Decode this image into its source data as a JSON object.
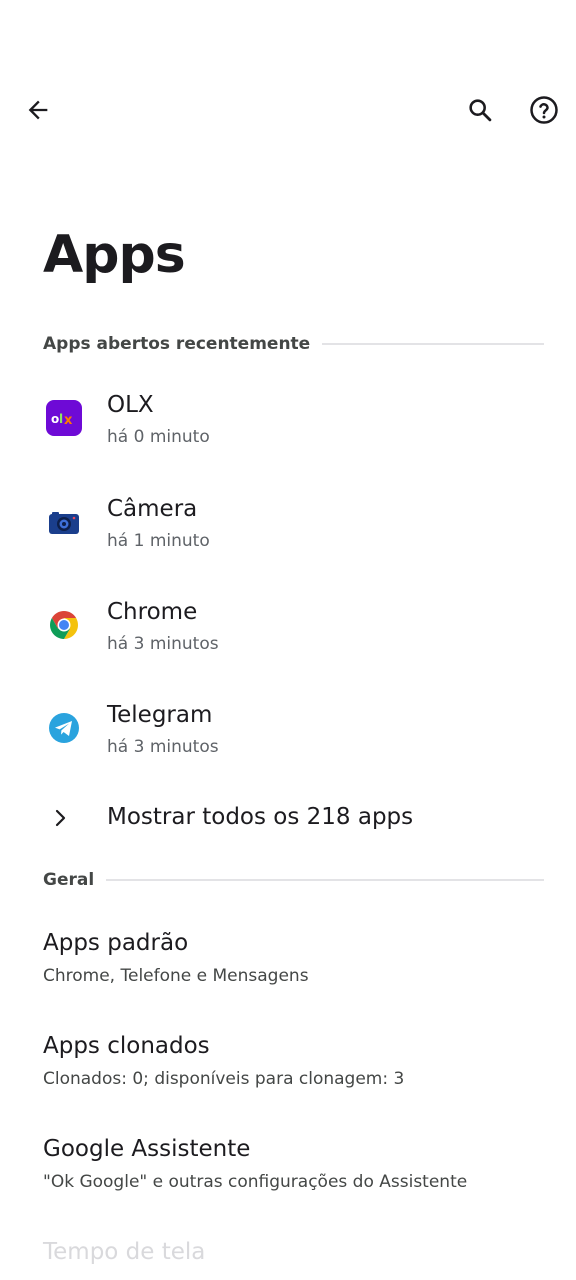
{
  "toolbar": {
    "back_icon": "arrow-back-icon",
    "search_icon": "search-icon",
    "help_icon": "help-circle-icon"
  },
  "page": {
    "title": "Apps"
  },
  "recent": {
    "header": "Apps abertos recentemente",
    "apps": [
      {
        "name": "OLX",
        "time": "há 0 minuto",
        "icon": "olx-app-icon",
        "icon_color": "#6e0ad6"
      },
      {
        "name": "Câmera",
        "time": "há 1 minuto",
        "icon": "camera-app-icon",
        "icon_color": "#1a3e8c"
      },
      {
        "name": "Chrome",
        "time": "há 3 minutos",
        "icon": "chrome-app-icon",
        "icon_color": "#4285f4"
      },
      {
        "name": "Telegram",
        "time": "há 3 minutos",
        "icon": "telegram-app-icon",
        "icon_color": "#2aa3de"
      }
    ],
    "show_all": "Mostrar todos os 218 apps"
  },
  "general": {
    "header": "Geral",
    "items": [
      {
        "title": "Apps padrão",
        "subtitle": "Chrome, Telefone e Mensagens"
      },
      {
        "title": "Apps clonados",
        "subtitle": "Clonados: 0; disponíveis para clonagem: 3"
      },
      {
        "title": "Google Assistente",
        "subtitle": "\"Ok Google\" e outras configurações do Assistente"
      },
      {
        "title": "Tempo de tela",
        "subtitle": ""
      }
    ]
  },
  "colors": {
    "background": "#ffffff",
    "text_primary": "#1c1b1f",
    "text_secondary": "#5f6368",
    "divider": "#e3e3e6"
  }
}
